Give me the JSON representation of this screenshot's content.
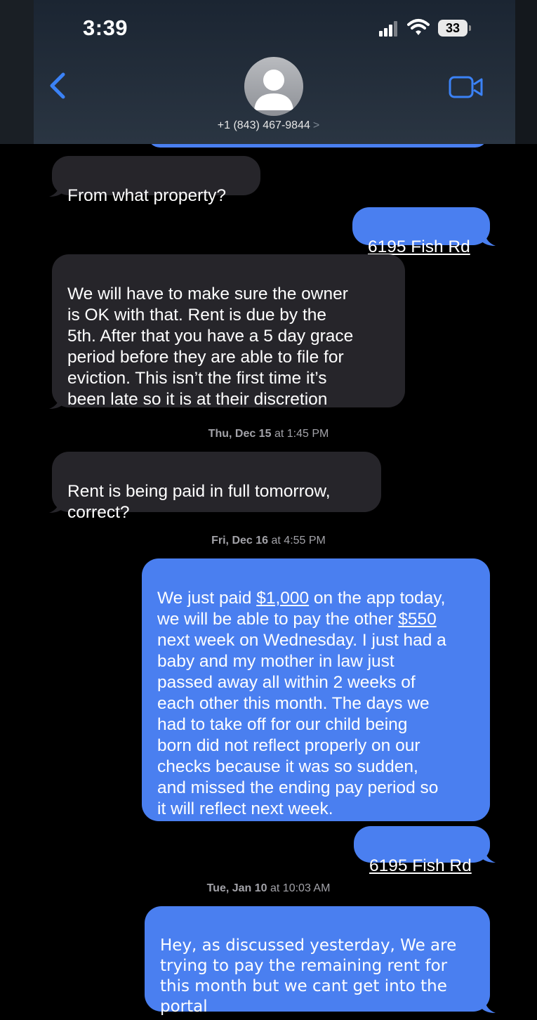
{
  "status_bar": {
    "time": "3:39",
    "battery": "33",
    "icons": [
      "cellular-signal-icon",
      "wifi-icon",
      "battery-icon"
    ]
  },
  "header": {
    "contact": "+1 (843) 467-9844",
    "contact_chevron": ">",
    "icons": [
      "back-chevron-icon",
      "avatar-person-icon",
      "video-call-icon"
    ]
  },
  "colors": {
    "sent_bubble": "#4a7ff0",
    "received_bubble": "#26252a",
    "accent": "#3b82f6",
    "background": "#000000"
  },
  "messages": [
    {
      "type": "received",
      "text": "From what property?"
    },
    {
      "type": "sent",
      "text": "6195 Fish Rd",
      "link": true
    },
    {
      "type": "received",
      "text": "We will have to make sure the owner\nis OK with that. Rent is due by the\n5th. After that you have a 5 day grace\nperiod before they are able to file for\neviction. This isn’t the first time it’s\nbeen late so it is at their discretion"
    },
    {
      "type": "timestamp",
      "day": "Thu, Dec 15",
      "time": "at 1:45 PM"
    },
    {
      "type": "received",
      "text": "Rent is being paid in full tomorrow,\ncorrect?"
    },
    {
      "type": "timestamp",
      "day": "Fri, Dec 16",
      "time": "at 4:55 PM"
    },
    {
      "type": "sent",
      "parts": [
        "We just paid ",
        "$1,000",
        " on the app today,\nwe will be able to pay the other ",
        "$550",
        "\nnext week on Wednesday. I just had a\nbaby and my mother in law just\npassed away all within 2 weeks of\neach other this month. The days we\nhad to take off for our child being\nborn did not reflect properly on our\nchecks because it was so sudden,\nand missed the ending pay period so\nit will reflect next week."
      ]
    },
    {
      "type": "sent",
      "text": "6195 Fish Rd",
      "link": true
    },
    {
      "type": "timestamp",
      "day": "Tue, Jan 10",
      "time": "at 10:03 AM"
    },
    {
      "type": "sent",
      "text": "Hey, as discussed yesterday, We are\ntrying to pay the remaining rent for\nthis month but we cant get into the\nportal"
    }
  ]
}
